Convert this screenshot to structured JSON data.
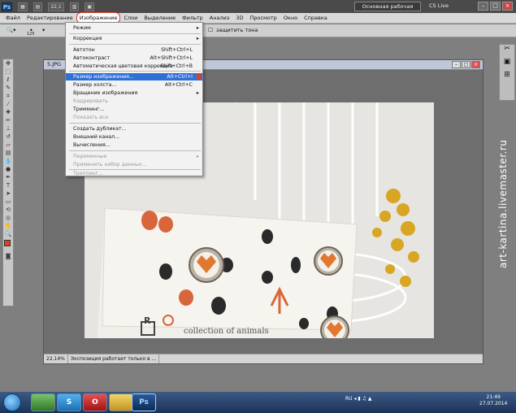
{
  "app": {
    "logo": "Ps",
    "zoom_control": "22,1",
    "workspace_button": "Основная рабочая среда",
    "cslive": "CS Live",
    "window_controls": [
      "–",
      "□",
      "×"
    ]
  },
  "menubar": {
    "items": [
      "Файл",
      "Редактирование",
      "Изображение",
      "Слои",
      "Выделение",
      "Фильтр",
      "Анализ",
      "3D",
      "Просмотр",
      "Окно",
      "Справка"
    ]
  },
  "options": {
    "size_value": "125",
    "right_label": "защитить тона"
  },
  "document": {
    "title": "5.JPG",
    "status_zoom": "22,14%",
    "status_text": "Экспозиция работает только в ..."
  },
  "image_menu": {
    "items": [
      {
        "label": "Режим",
        "shortcut": "",
        "submenu": true,
        "disabled": false
      },
      {
        "label": "Коррекция",
        "shortcut": "",
        "submenu": true,
        "disabled": false
      },
      {
        "label": "Автотон",
        "shortcut": "Shift+Ctrl+L",
        "submenu": false,
        "disabled": false
      },
      {
        "label": "Автоконтраст",
        "shortcut": "Alt+Shift+Ctrl+L",
        "submenu": false,
        "disabled": false
      },
      {
        "label": "Автоматическая цветовая коррекция",
        "shortcut": "Shift+Ctrl+B",
        "submenu": false,
        "disabled": false
      },
      {
        "label": "Размер изображения...",
        "shortcut": "Alt+Ctrl+I",
        "submenu": false,
        "disabled": false,
        "highlighted": true
      },
      {
        "label": "Размер холста...",
        "shortcut": "Alt+Ctrl+C",
        "submenu": false,
        "disabled": false
      },
      {
        "label": "Вращение изображения",
        "shortcut": "",
        "submenu": true,
        "disabled": false
      },
      {
        "label": "Кадрировать",
        "shortcut": "",
        "submenu": false,
        "disabled": true
      },
      {
        "label": "Тримминг...",
        "shortcut": "",
        "submenu": false,
        "disabled": false
      },
      {
        "label": "Показать все",
        "shortcut": "",
        "submenu": false,
        "disabled": true
      },
      {
        "label": "Создать дубликат...",
        "shortcut": "",
        "submenu": false,
        "disabled": false
      },
      {
        "label": "Внешний канал...",
        "shortcut": "",
        "submenu": false,
        "disabled": false
      },
      {
        "label": "Вычисления...",
        "shortcut": "",
        "submenu": false,
        "disabled": false
      },
      {
        "label": "Переменные",
        "shortcut": "",
        "submenu": true,
        "disabled": true
      },
      {
        "label": "Применить набор данных...",
        "shortcut": "",
        "submenu": false,
        "disabled": true
      },
      {
        "label": "Треппинг...",
        "shortcut": "",
        "submenu": false,
        "disabled": true
      }
    ]
  },
  "photo": {
    "card_text": "collection of animals",
    "logo_letter": "R"
  },
  "taskbar": {
    "lang": "RU",
    "time": "21:49",
    "date": "27.07.2014",
    "apps": [
      "",
      "S",
      "O",
      "",
      "Ps"
    ]
  },
  "watermark": "art-kartina.livemaster.ru",
  "colors": {
    "accent": "#e23b2b",
    "highlight": "#2f6fd6",
    "taskbar": "#1c3358"
  }
}
